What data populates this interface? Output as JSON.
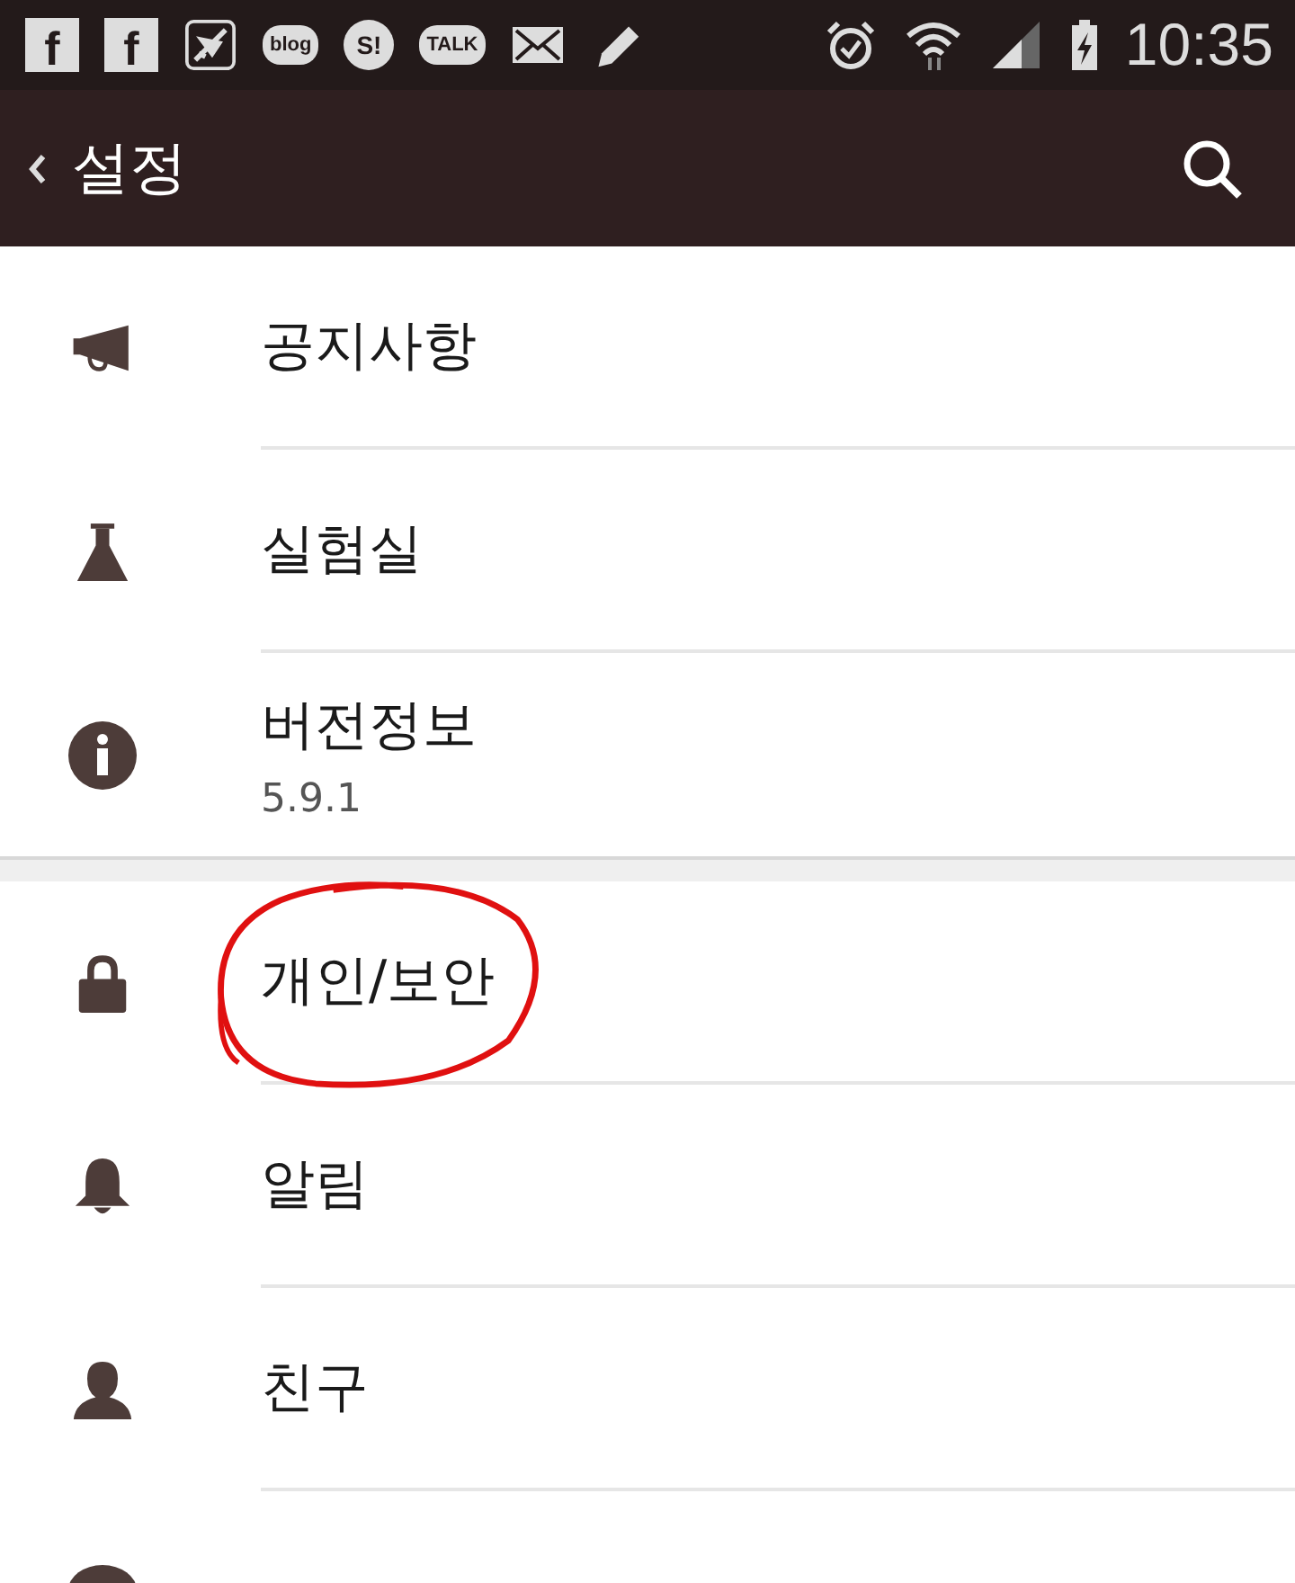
{
  "status_bar": {
    "notification_icons": [
      {
        "kind": "square",
        "text": "f"
      },
      {
        "kind": "square",
        "text": "f"
      },
      {
        "kind": "airplane"
      },
      {
        "kind": "bubble",
        "text": "blog"
      },
      {
        "kind": "round",
        "text": "S!"
      },
      {
        "kind": "bubble",
        "text": "TALK"
      },
      {
        "kind": "mail"
      },
      {
        "kind": "pencil"
      }
    ],
    "time": "10:35"
  },
  "header": {
    "title": "설정"
  },
  "sections": [
    {
      "items": [
        {
          "kind": "megaphone",
          "label": "공지사항",
          "circled": false
        },
        {
          "kind": "flask",
          "label": "실험실",
          "circled": false
        },
        {
          "kind": "info",
          "label": "버전정보",
          "detail": "5.9.1",
          "circled": false
        }
      ]
    },
    {
      "items": [
        {
          "kind": "lock",
          "label": "개인/보안",
          "circled": true
        },
        {
          "kind": "bell",
          "label": "알림",
          "circled": false
        },
        {
          "kind": "person",
          "label": "친구",
          "circled": false
        },
        {
          "kind": "chat"
        }
      ]
    }
  ]
}
